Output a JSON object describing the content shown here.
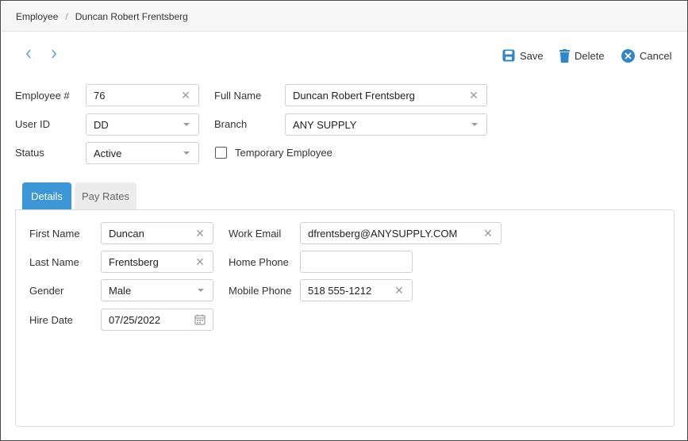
{
  "breadcrumb": {
    "root": "Employee",
    "separator": "/",
    "current": "Duncan Robert Frentsberg"
  },
  "toolbar": {
    "save": "Save",
    "delete": "Delete",
    "cancel": "Cancel"
  },
  "header_form": {
    "employee_no_label": "Employee #",
    "employee_no_value": "76",
    "full_name_label": "Full Name",
    "full_name_value": "Duncan Robert Frentsberg",
    "user_id_label": "User ID",
    "user_id_value": "DD",
    "branch_label": "Branch",
    "branch_value": "ANY SUPPLY",
    "status_label": "Status",
    "status_value": "Active",
    "temporary_label": "Temporary Employee",
    "temporary_checked": false
  },
  "tabs": [
    {
      "label": "Details",
      "active": true
    },
    {
      "label": "Pay Rates",
      "active": false
    }
  ],
  "details": {
    "first_name_label": "First Name",
    "first_name_value": "Duncan",
    "last_name_label": "Last Name",
    "last_name_value": "Frentsberg",
    "gender_label": "Gender",
    "gender_value": "Male",
    "hire_date_label": "Hire Date",
    "hire_date_value": "07/25/2022",
    "work_email_label": "Work Email",
    "work_email_value": "dfrentsberg@ANYSUPPLY.COM",
    "home_phone_label": "Home Phone",
    "home_phone_value": "",
    "mobile_phone_label": "Mobile Phone",
    "mobile_phone_value": "518 555-1212"
  },
  "colors": {
    "accent": "#3d96d6",
    "icon_blue": "#2f86c9"
  },
  "icons": [
    "chevron-left-icon",
    "chevron-right-icon",
    "save-icon",
    "trash-icon",
    "cancel-circle-icon",
    "clear-icon",
    "dropdown-caret-icon",
    "calendar-icon"
  ]
}
